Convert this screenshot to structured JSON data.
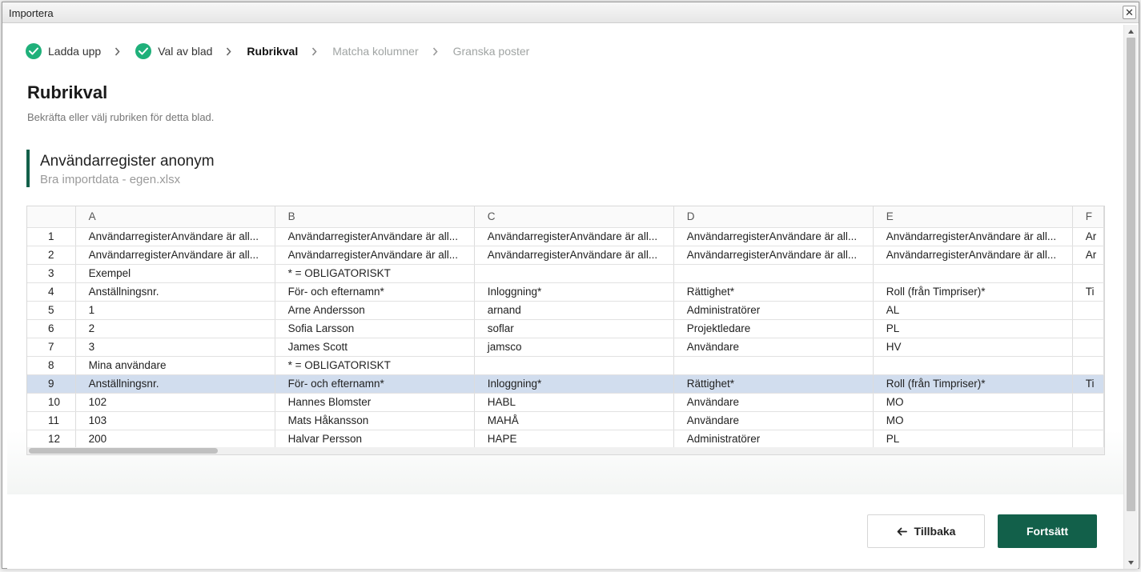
{
  "dialog": {
    "title": "Importera",
    "close_symbol": "✕"
  },
  "stepper": {
    "steps": [
      {
        "label": "Ladda upp",
        "state": "done"
      },
      {
        "label": "Val av blad",
        "state": "done"
      },
      {
        "label": "Rubrikval",
        "state": "active"
      },
      {
        "label": "Matcha kolumner",
        "state": "future"
      },
      {
        "label": "Granska poster",
        "state": "future"
      }
    ]
  },
  "page": {
    "title": "Rubrikval",
    "subtitle": "Bekräfta eller välj rubriken för detta blad."
  },
  "sheet": {
    "name": "Användarregister anonym",
    "file": "Bra importdata - egen.xlsx"
  },
  "grid": {
    "columns": [
      "A",
      "B",
      "C",
      "D",
      "E",
      "F"
    ],
    "selected_row": 9,
    "rows": [
      {
        "n": "1",
        "cells": [
          "AnvändarregisterAnvändare är all...",
          "AnvändarregisterAnvändare är all...",
          "AnvändarregisterAnvändare är all...",
          "AnvändarregisterAnvändare är all...",
          "AnvändarregisterAnvändare är all...",
          "Ar"
        ]
      },
      {
        "n": "2",
        "cells": [
          "AnvändarregisterAnvändare är all...",
          "AnvändarregisterAnvändare är all...",
          "AnvändarregisterAnvändare är all...",
          "AnvändarregisterAnvändare är all...",
          "AnvändarregisterAnvändare är all...",
          "Ar"
        ]
      },
      {
        "n": "3",
        "cells": [
          "Exempel",
          "* = OBLIGATORISKT",
          "",
          "",
          "",
          ""
        ]
      },
      {
        "n": "4",
        "cells": [
          "Anställningsnr.",
          "För- och efternamn*",
          "Inloggning*",
          "Rättighet*",
          "Roll (från Timpriser)*",
          "Ti"
        ]
      },
      {
        "n": "5",
        "cells": [
          "1",
          "Arne Andersson",
          "arnand",
          "Administratörer",
          "AL",
          ""
        ]
      },
      {
        "n": "6",
        "cells": [
          "2",
          "Sofia Larsson",
          "soflar",
          "Projektledare",
          "PL",
          ""
        ]
      },
      {
        "n": "7",
        "cells": [
          "3",
          "James Scott",
          "jamsco",
          "Användare",
          "HV",
          ""
        ]
      },
      {
        "n": "8",
        "cells": [
          "Mina användare",
          "* = OBLIGATORISKT",
          "",
          "",
          "",
          ""
        ]
      },
      {
        "n": "9",
        "cells": [
          "Anställningsnr.",
          "För- och efternamn*",
          "Inloggning*",
          "Rättighet*",
          "Roll (från Timpriser)*",
          "Ti"
        ]
      },
      {
        "n": "10",
        "cells": [
          "102",
          "Hannes Blomster",
          "HABL",
          "Användare",
          "MO",
          ""
        ]
      },
      {
        "n": "11",
        "cells": [
          "103",
          "Mats Håkansson",
          "MAHÅ",
          "Användare",
          "MO",
          ""
        ]
      },
      {
        "n": "12",
        "cells": [
          "200",
          "Halvar Persson",
          "HAPE",
          "Administratörer",
          "PL",
          ""
        ]
      }
    ]
  },
  "footer": {
    "back_label": "Tillbaka",
    "continue_label": "Fortsätt"
  },
  "colors": {
    "primary": "#12604a",
    "check": "#1fb07a",
    "selected_row": "#d1ddee"
  }
}
